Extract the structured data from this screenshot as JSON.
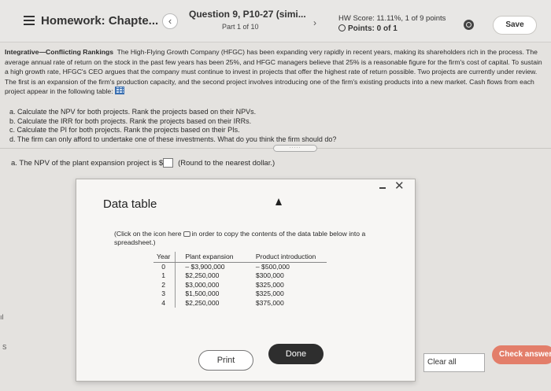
{
  "header": {
    "menu_icon": "hamburger-icon",
    "hw_title": "Homework: Chapte...",
    "prev_icon": "‹",
    "question_title": "Question 9, P10-27 (simi...",
    "question_part": "Part 1 of 10",
    "next_icon": "›",
    "hw_score": "HW Score: 11.11%, 1 of 9 points",
    "points": "Points: 0 of 1",
    "save_label": "Save"
  },
  "problem": {
    "lead": "Integrative—Conflicting Rankings",
    "body": "The High-Flying Growth Company (HFGC) has been expanding very rapidly in recent years, making its shareholders rich in the process. The average annual rate of return on the stock in the past few years has been 25%, and HFGC managers believe that 25% is a reasonable figure for the firm's cost of capital. To sustain a high growth rate, HFGC's CEO argues that the company must continue to invest in projects that offer the highest rate of return possible. Two projects are currently under review. The first is an expansion of the firm's production capacity, and the second project involves introducing one of the firm's existing products into a new market. Cash flows from each project appear in the following table:"
  },
  "tasks": [
    "a.  Calculate the NPV for both projects.  Rank the projects based on their NPVs.",
    "b.  Calculate the IRR for both projects.  Rank the projects based on their IRRs.",
    "c.  Calculate the PI for both projects.  Rank the projects based on their PIs.",
    "d.  The firm can only afford to undertake one of these investments.  What do you think the firm should do?"
  ],
  "more_label": "·····",
  "answer": {
    "prefix": "a.  The NPV of the plant expansion project is $",
    "hint": "(Round to the nearest dollar.)"
  },
  "modal": {
    "title": "Data table",
    "instr_before": "(Click on the icon here",
    "instr_after": "in order to copy the contents of the data table below into a spreadsheet.)",
    "columns": [
      "Year",
      "Plant expansion",
      "Product introduction"
    ],
    "rows": [
      [
        "0",
        "– $3,900,000",
        "– $500,000"
      ],
      [
        "1",
        "$2,250,000",
        "$300,000"
      ],
      [
        "2",
        "$3,000,000",
        "$325,000"
      ],
      [
        "3",
        "$1,500,000",
        "$325,000"
      ],
      [
        "4",
        "$2,250,000",
        "$375,000"
      ]
    ],
    "print_label": "Print",
    "done_label": "Done",
    "close_label": "✕"
  },
  "footer": {
    "clear_label": "Clear all",
    "check_label": "Check answer"
  },
  "side_marks": [
    "ıl",
    "S"
  ],
  "colors": {
    "check_button": "#e37e6a",
    "done_button": "#2e2e2e",
    "table_icon": "#3a6fb0"
  }
}
